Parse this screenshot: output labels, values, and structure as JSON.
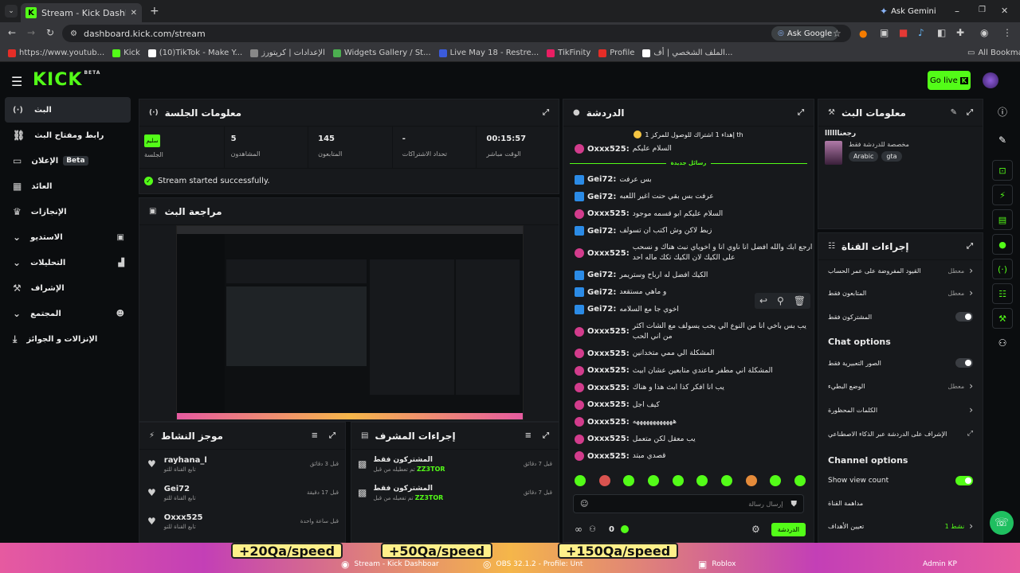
{
  "browser": {
    "tab_title": "Stream - Kick Dashboard",
    "ask_gemini": "Ask Gemini",
    "url": "dashboard.kick.com/stream",
    "ask_google": "Ask Google",
    "bookmarks": [
      {
        "label": "https://www.youtub...",
        "color": "#e52d27"
      },
      {
        "label": "Kick",
        "color": "#53fc18"
      },
      {
        "label": "(10)TikTok - Make Y...",
        "color": "#ffffff"
      },
      {
        "label": "الإعدادات | كريتورز",
        "color": "#888888"
      },
      {
        "label": "Widgets Gallery / St...",
        "color": "#4caf50"
      },
      {
        "label": "Live May 18 - Restre...",
        "color": "#3b5bdb"
      },
      {
        "label": "TikFinity",
        "color": "#e91e63"
      },
      {
        "label": "Profile",
        "color": "#e52d27"
      },
      {
        "label": "الملف الشخصي | أف...",
        "color": "#ffffff"
      }
    ],
    "all_bookmarks": "All Bookmarks"
  },
  "app": {
    "logo": "KICK",
    "logo_beta": "BETA",
    "go_live": "Go live"
  },
  "sidebar": {
    "items": [
      {
        "label": "البث",
        "icon": "broadcast-icon"
      },
      {
        "label": "رابط ومفتاح البث",
        "icon": "link-icon"
      },
      {
        "label": "الإعلان",
        "icon": "ad-icon",
        "tag": "Beta"
      },
      {
        "label": "العائد",
        "icon": "revenue-icon"
      },
      {
        "label": "الإنجازات",
        "icon": "trophy-icon"
      },
      {
        "label": "الاستديو",
        "icon": "studio-icon"
      },
      {
        "label": "التحليلات",
        "icon": "analytics-icon"
      },
      {
        "label": "الإشراف",
        "icon": "moderation-icon"
      },
      {
        "label": "المجتمع",
        "icon": "community-icon"
      },
      {
        "label": "الإنزالات و الجوائز",
        "icon": "drops-icon"
      }
    ]
  },
  "session": {
    "title": "معلومات الجلسة",
    "status_pill": "سليم",
    "stats": [
      {
        "value": "",
        "label": "الجلسة"
      },
      {
        "value": "5",
        "label": "المشاهدون"
      },
      {
        "value": "145",
        "label": "المتابعون"
      },
      {
        "value": "-",
        "label": "تحداد الاشتراكات"
      },
      {
        "value": "00:15:57",
        "label": "الوقت مباشر"
      }
    ],
    "success": "Stream started successfully."
  },
  "preview": {
    "title": "مراجعة البث"
  },
  "activity": {
    "title": "موجز النشاط",
    "items": [
      {
        "user": "rayhana_l",
        "sub": "تابع القناة للتو",
        "time": "قبل 3 دقائق"
      },
      {
        "user": "Gei72",
        "sub": "تابع القناة للتو",
        "time": "قبل 17 دقيقة"
      },
      {
        "user": "Oxxx525",
        "sub": "تابع القناة للتو",
        "time": "قبل ساعة واحدة"
      }
    ]
  },
  "modactions": {
    "title": "إجراءات المشرف",
    "items": [
      {
        "title": "المشتركون فقط",
        "sub": "تم تعطيله من قبل",
        "by": "ZZ3TOR",
        "time": "قبل 7 دقائق"
      },
      {
        "title": "المشتركون فقط",
        "sub": "تم تفعيله من قبل",
        "by": "ZZ3TOR",
        "time": "قبل 7 دقائق"
      }
    ]
  },
  "chat": {
    "title": "الدردشة",
    "goal": "إهداء 1 اشتراك للوصول للمركز 1 th",
    "pinned": {
      "user": "Oxxx525:",
      "msg": "السلام عليكم"
    },
    "new_messages": "رسائل جديدة",
    "messages": [
      {
        "user": "Gei72:",
        "msg": "بس عرفت",
        "badge": "b"
      },
      {
        "user": "Gei72:",
        "msg": "عرفت بس بقي حنت اغير اللعبه",
        "badge": "b"
      },
      {
        "user": "Oxxx525:",
        "msg": "السلام عليكم ابو قسمه موجود",
        "badge": "p"
      },
      {
        "user": "Gei72:",
        "msg": "زبط لاكن وش اكتب ان تسولف",
        "badge": "b"
      },
      {
        "user": "Oxxx525:",
        "msg": "ارجع ابك والله افضل انا ناوي انا و اخوياي نبث هناك و نسحب على الكيك لان الكيك تكك ماله احد",
        "badge": "p"
      },
      {
        "user": "Gei72:",
        "msg": "الكيك افضل له ارباح وستريمر",
        "badge": "b"
      },
      {
        "user": "Gei72:",
        "msg": "و ماهي مستقعد",
        "badge": "b"
      },
      {
        "user": "Gei72:",
        "msg": "اخوي جا مع السلامه",
        "badge": "b"
      },
      {
        "user": "Oxxx525:",
        "msg": "يب بس باخي انا من النوع الي يحب يسولف مع الشات اكثر من اني الحب",
        "badge": "p"
      },
      {
        "user": "Oxxx525:",
        "msg": "المشكلة الي ممي متخدانين",
        "badge": "p"
      },
      {
        "user": "Oxxx525:",
        "msg": "المشكلة اني مطفر ماعندي متابعين عشان ابيث",
        "badge": "p"
      },
      {
        "user": "Oxxx525:",
        "msg": "يب انا افكر كذا ابث هذا و هناك",
        "badge": "p"
      },
      {
        "user": "Oxxx525:",
        "msg": "كيف اجل",
        "badge": "p"
      },
      {
        "user": "Oxxx525:",
        "msg": "ههههههههههههه",
        "badge": "p"
      },
      {
        "user": "Oxxx525:",
        "msg": "يب معقل لكن متعمل",
        "badge": "p"
      },
      {
        "user": "Oxxx525:",
        "msg": "قصدي مبتد",
        "badge": "p"
      }
    ],
    "placeholder": "إرسال رسالة",
    "count": "0",
    "send": "الدردشة"
  },
  "streaminfo": {
    "title": "معلومات البث",
    "stream_title": "رجعناااااا",
    "category_desc": "مخصصة للدردشة فقط",
    "tags": [
      "Arabic",
      "gta"
    ]
  },
  "channelactions": {
    "title": "إجراءات القناة",
    "rows": [
      {
        "label": "القيود المفروضة على عمر الحساب",
        "state": "معطل"
      },
      {
        "label": "المتابعون فقط",
        "state": "معطل"
      }
    ],
    "subs_only": "المشتركون فقط",
    "chat_options_title": "Chat options",
    "emotes_only": "الصور التعبيرية فقط",
    "slow_mode": "الوضع البطيء",
    "slow_mode_state": "معطل",
    "banned_words": "الكلمات المحظورة",
    "ai_mod": "الإشراف على الدردشة عبر الذكاء الاصطناعي",
    "channel_options_title": "Channel options",
    "show_view_count": "Show view count",
    "raid": "مداهمة القناة",
    "goals": "تعيين الأهداف",
    "goals_state": "نشط 1"
  },
  "taskbar": {
    "speed1": "+20Qa/speed",
    "speed2": "+50Qa/speed",
    "speed3": "+150Qa/speed",
    "app1": "Stream - Kick Dashboar",
    "app2": "OBS 32.1.2 - Profile: Unt",
    "app3": "Roblox",
    "user": "Admin KP"
  }
}
